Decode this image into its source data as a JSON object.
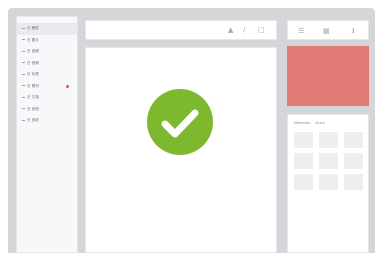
{
  "sidebar": {
    "items": [
      {
        "label": "日 稿件"
      },
      {
        "label": "日 图片"
      },
      {
        "label": "日 音频"
      },
      {
        "label": "日 视频"
      },
      {
        "label": "日 标签"
      },
      {
        "label": "日 素材"
      },
      {
        "label": "日 文档"
      },
      {
        "label": "日 其他"
      },
      {
        "label": "日 回收"
      }
    ],
    "active_index": 0,
    "flagged_index": 5
  },
  "toolbar": {
    "icons": [
      "lock-icon",
      "link-icon",
      "share-icon"
    ]
  },
  "canvas": {
    "status_icon": "checkmark-icon",
    "status_color": "#7eb82f"
  },
  "right_toolbar": {
    "icons": [
      "list-icon",
      "grid-icon",
      "info-icon"
    ]
  },
  "preview": {
    "color": "#e07a74"
  },
  "right_panel": {
    "tabs": [
      {
        "label": "Metadata"
      },
      {
        "label": "Share"
      }
    ]
  }
}
